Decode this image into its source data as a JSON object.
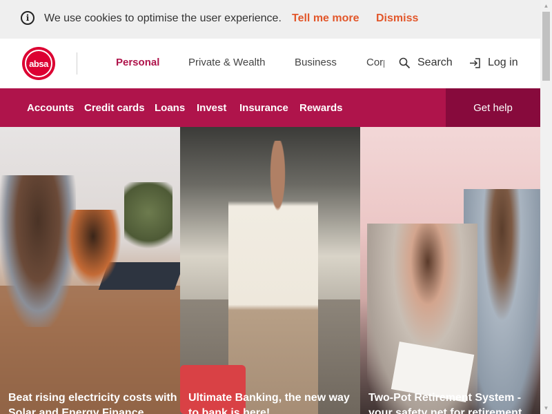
{
  "cookie_bar": {
    "message": "We use cookies to optimise the user experience.",
    "tell_more": "Tell me more",
    "dismiss": "Dismiss"
  },
  "header": {
    "logo_text": "absa",
    "top_nav": [
      "Personal",
      "Private & Wealth",
      "Business",
      "Corporate"
    ],
    "active_top_nav": "Personal",
    "search_label": "Search",
    "login_label": "Log in"
  },
  "main_nav": {
    "items": [
      "Accounts",
      "Credit cards",
      "Loans",
      "Invest",
      "Insurance",
      "Rewards"
    ],
    "get_help": "Get help"
  },
  "cards": [
    {
      "title": "Beat rising electricity costs with Solar and Energy Finance"
    },
    {
      "title": "Ultimate Banking, the new way to bank is here!"
    },
    {
      "title": "Two-Pot Retirement System - your safety net for retirement"
    }
  ],
  "colors": {
    "brand_magenta": "#af144b",
    "brand_dark": "#870a3c",
    "cookie_link": "#e2572b",
    "logo_red": "#dc0032"
  },
  "icons": [
    "info-icon",
    "search-icon",
    "login-icon"
  ]
}
